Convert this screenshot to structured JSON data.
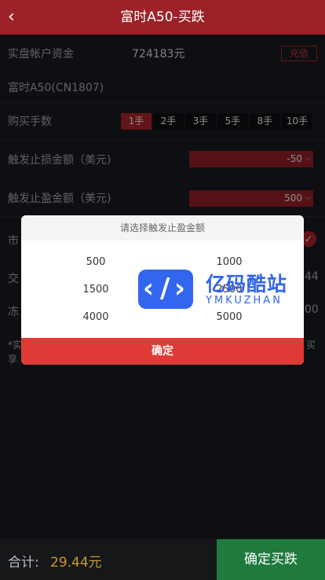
{
  "header": {
    "title": "富时A50-买跌",
    "back_icon": "chevron-left-icon"
  },
  "account": {
    "label": "实盘帐户资金",
    "value": "724183元",
    "recharge_label": "充值"
  },
  "contract": {
    "label": "富时A50(CN1807)"
  },
  "lots": {
    "label": "购买手数",
    "options": [
      "1手",
      "2手",
      "3手",
      "5手",
      "8手",
      "10手"
    ],
    "selected": "1手"
  },
  "stop_loss": {
    "label": "触发止损金额（美元)",
    "value": "-50"
  },
  "take_profit": {
    "label": "触发止盈金额（美元)",
    "value": "500"
  },
  "behind_partial": {
    "row1": "市",
    "row2": "交",
    "row3": "冻",
    "row4a": "*实",
    "row4b": "享",
    "val2": "44",
    "val3": "00",
    "row4r": "买"
  },
  "modal": {
    "title": "请选择触发止盈金额",
    "options": [
      "500",
      "1000",
      "1500",
      "2500",
      "4000",
      "5000"
    ],
    "confirm_label": "确定"
  },
  "watermark": {
    "name": "亿码酷站",
    "sub": "YMKUZHAN"
  },
  "footer": {
    "total_label": "合计:",
    "total_value": "29.44元",
    "buy_label": "确定买跌"
  },
  "colors": {
    "header": "#9c2128",
    "accent_red": "#b5262c",
    "buy_green": "#1e7a3d",
    "total_gold": "#c99a2e"
  }
}
